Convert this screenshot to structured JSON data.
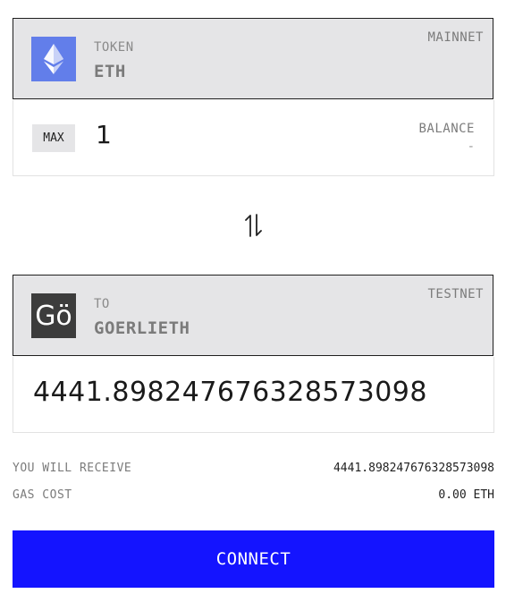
{
  "from": {
    "label": "TOKEN",
    "token": "ETH",
    "network": "MAINNET",
    "icon": "eth-icon",
    "icon_color": "#627eea"
  },
  "amount": {
    "max_label": "MAX",
    "value": "1",
    "balance_label": "BALANCE",
    "balance_value": "-"
  },
  "swap": {
    "icon": "swap-arrows-icon"
  },
  "to": {
    "label": "TO",
    "token": "GOERLIETH",
    "network": "TESTNET",
    "icon_text": "Gö",
    "icon_color": "#3c3c3c"
  },
  "receive": {
    "amount": "4441.898247676328573098"
  },
  "summary": {
    "receive_label": "YOU WILL RECEIVE",
    "receive_value": "4441.898247676328573098",
    "gas_label": "GAS COST",
    "gas_value": "0.00 ETH"
  },
  "connect_label": "CONNECT",
  "colors": {
    "accent": "#1414ff",
    "panel_bg": "#e5e5e7"
  }
}
